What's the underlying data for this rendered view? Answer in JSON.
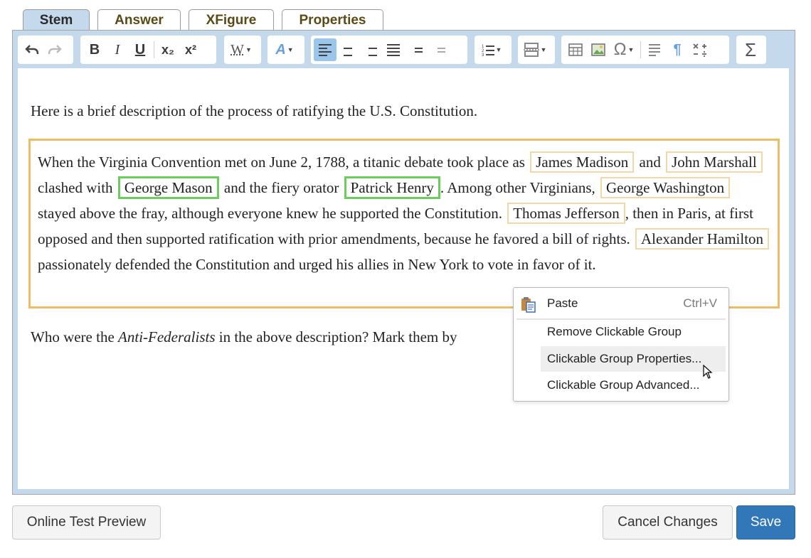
{
  "tabs": [
    {
      "label": "Stem",
      "active": true
    },
    {
      "label": "Answer",
      "active": false
    },
    {
      "label": "XFigure",
      "active": false
    },
    {
      "label": "Properties",
      "active": false
    }
  ],
  "toolbar": {
    "bold": "B",
    "italic": "I",
    "underline": "U",
    "subscript": "x₂",
    "superscript": "x²",
    "font_style": "W",
    "text_color": "A",
    "omega": "Ω",
    "pilcrow": "¶",
    "sigma": "Σ"
  },
  "content": {
    "intro": "Here is a brief description of the process of ratifying the U.S. Constitution.",
    "group": {
      "t1": "When the Virginia Convention met on June 2, 1788, a titanic debate took place as",
      "c1": "James Madison",
      "t2": "and",
      "c2": "John Marshall",
      "t3": "clashed with",
      "c3": "George Mason",
      "t4": "and the fiery orator",
      "c4": "Patrick Henry",
      "t5": ". Among other Virginians,",
      "c5": "George Washington",
      "t6": "stayed above the fray, although everyone knew he supported the Constitution.",
      "c6": "Thomas Jefferson",
      "t7": ", then in Paris, at first opposed and then supported ratification with prior amendments, because he favored a bill of rights.",
      "c7": "Alexander Hamilton",
      "t8": "passionately defended the Constitution and urged his allies in New York to vote in favor of it."
    },
    "question_pre": "Who were the",
    "question_em": "Anti-Federalists",
    "question_post": "in the above description? Mark them by"
  },
  "context_menu": {
    "paste": "Paste",
    "paste_shortcut": "Ctrl+V",
    "remove": "Remove Clickable Group",
    "properties": "Clickable Group Properties...",
    "advanced": "Clickable Group Advanced..."
  },
  "buttons": {
    "preview": "Online Test Preview",
    "cancel": "Cancel Changes",
    "save": "Save"
  },
  "colors": {
    "accent": "#3278b8",
    "toolbar_bg": "#c4d9ec",
    "group_border": "#ebbd66",
    "chip_selected": "#6ccd5e",
    "chip_unselected": "#f3d8a7"
  }
}
